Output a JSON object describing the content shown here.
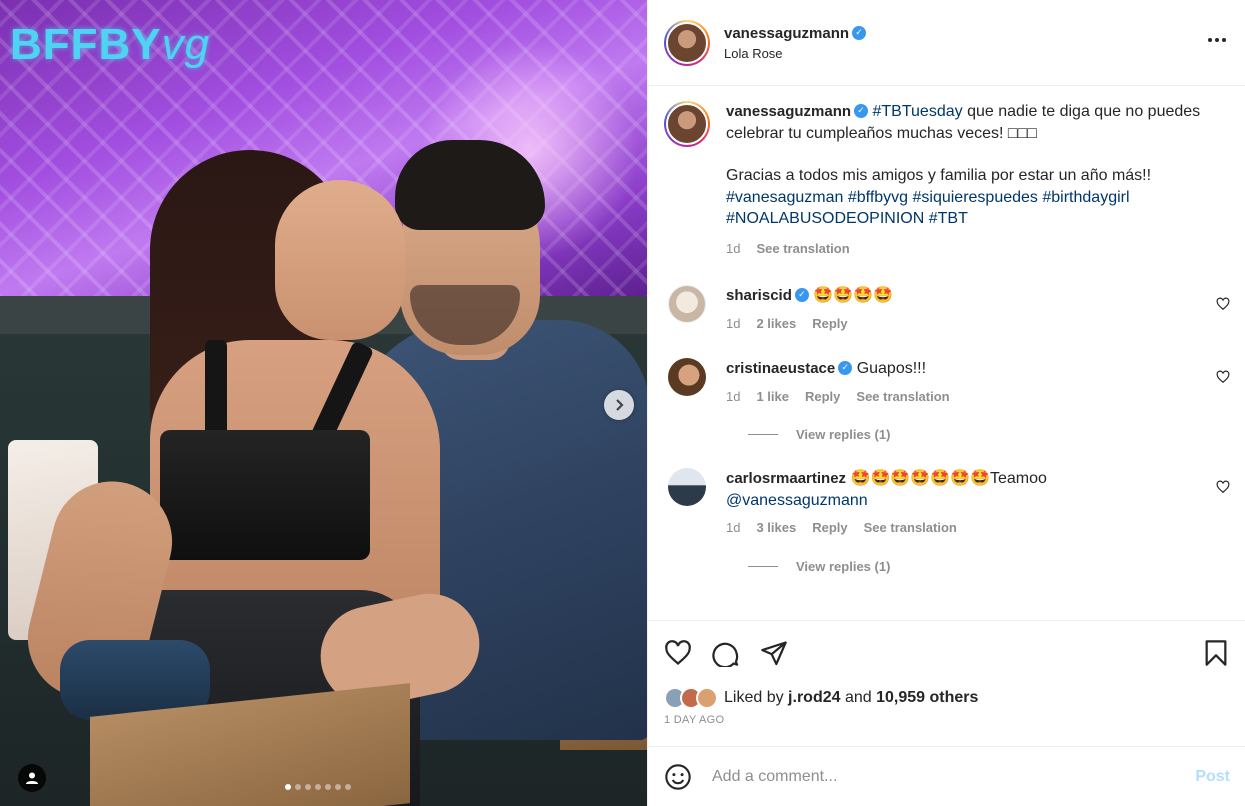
{
  "media": {
    "brand_logo_text": "BFFBY",
    "brand_logo_suffix": "vg",
    "carousel": {
      "total": 7,
      "current": 1
    },
    "next_icon": "chevron-right-icon",
    "tag_icon": "user-icon"
  },
  "header": {
    "username": "vanessaguzmann",
    "verified": true,
    "location": "Lola Rose",
    "more_icon": "more-horizontal-icon"
  },
  "caption": {
    "username": "vanessaguzmann",
    "hashtag_lead": "#TBTuesday",
    "text_1": " que nadie te diga que no puedes celebrar tu cumpleaños muchas veces! □□□",
    "text_2": "Gracias a todos mis amigos y familia por estar un año más!!",
    "hashtags": "#vanesaguzman #bffbyvg #siquierespuedes #birthdaygirl #NOALABUSODEOPINION #TBT",
    "time": "1d",
    "translate": "See translation"
  },
  "comments": [
    {
      "username": "shariscid",
      "verified": true,
      "text": "🤩🤩🤩🤩",
      "time": "1d",
      "likes": "2 likes",
      "reply": "Reply",
      "translate": "",
      "replies": ""
    },
    {
      "username": "cristinaeustace",
      "verified": true,
      "text": "Guapos!!!",
      "time": "1d",
      "likes": "1 like",
      "reply": "Reply",
      "translate": "See translation",
      "replies": "View replies (1)"
    },
    {
      "username": "carlosrmaartinez",
      "verified": false,
      "text": "🤩🤩🤩🤩🤩🤩🤩Teamoo",
      "mention": "@vanessaguzmann",
      "time": "1d",
      "likes": "3 likes",
      "reply": "Reply",
      "translate": "See translation",
      "replies": "View replies (1)"
    }
  ],
  "actions": {
    "like_icon": "heart-icon",
    "comment_icon": "comment-icon",
    "share_icon": "send-icon",
    "save_icon": "bookmark-icon",
    "liked_by_prefix": "Liked by ",
    "liked_by_user": "j.rod24",
    "liked_by_and": " and ",
    "liked_by_others": "10,959 others",
    "timestamp": "1 DAY AGO"
  },
  "add_comment": {
    "emoji_icon": "emoji-icon",
    "placeholder": "Add a comment...",
    "post_label": "Post"
  },
  "colors": {
    "link": "#00376b",
    "verified": "#3897f0",
    "muted": "#8e8e8e",
    "post_disabled": "#b2dffc"
  }
}
